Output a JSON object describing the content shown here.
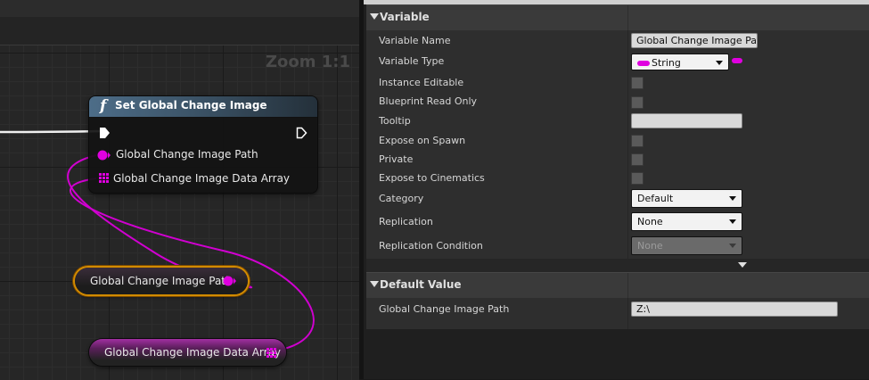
{
  "graph": {
    "zoom_label": "Zoom 1:1",
    "function_node": {
      "icon": "f",
      "title": "Set Global Change Image",
      "pins": [
        {
          "label": "Global Change Image Path",
          "type": "string",
          "color": "#e000e0"
        },
        {
          "label": "Global Change Image Data Array",
          "type": "string-array",
          "color": "#e000e0"
        }
      ]
    },
    "variable_nodes": [
      {
        "label": "Global Change Image Path",
        "selected": true
      },
      {
        "label": "Global Change Image Data Array",
        "selected": false
      }
    ],
    "colors": {
      "string_pin": "#e000e0",
      "selection": "#d28b00",
      "exec": "#ffffff"
    }
  },
  "details": {
    "variable_section": {
      "title": "Variable",
      "rows": {
        "variable_name": {
          "label": "Variable Name",
          "value": "Global Change Image Path"
        },
        "variable_type": {
          "label": "Variable Type",
          "value": "String"
        },
        "instance_editable": {
          "label": "Instance Editable",
          "checked": false
        },
        "blueprint_read_only": {
          "label": "Blueprint Read Only",
          "checked": false
        },
        "tooltip": {
          "label": "Tooltip",
          "value": ""
        },
        "expose_on_spawn": {
          "label": "Expose on Spawn",
          "checked": false
        },
        "private": {
          "label": "Private",
          "checked": false
        },
        "expose_to_cinematics": {
          "label": "Expose to Cinematics",
          "checked": false
        },
        "category": {
          "label": "Category",
          "value": "Default"
        },
        "replication": {
          "label": "Replication",
          "value": "None"
        },
        "replication_condition": {
          "label": "Replication Condition",
          "value": "None"
        }
      }
    },
    "default_value_section": {
      "title": "Default Value",
      "rows": {
        "path": {
          "label": "Global Change Image Path",
          "value": "Z:\\"
        }
      }
    }
  }
}
